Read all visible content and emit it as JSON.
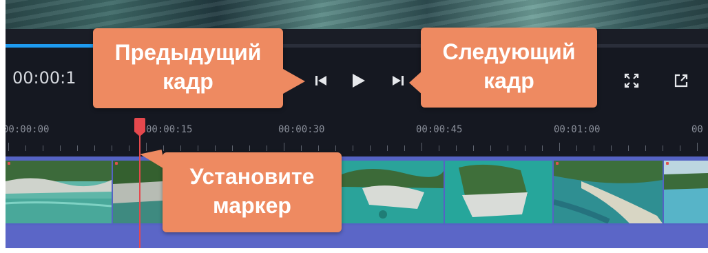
{
  "player": {
    "timecode": "00:00:1",
    "progress_fraction": 0.13,
    "accent_color": "#1e9bf0",
    "buttons": {
      "prev_frame_icon": "skip-previous-icon",
      "play_icon": "play-icon",
      "next_frame_icon": "skip-next-icon",
      "fullscreen_icon": "fullscreen-icon",
      "popout_icon": "open-external-icon"
    }
  },
  "timeline": {
    "ruler_labels": [
      "00:00:00",
      "00:00:15",
      "00:00:30",
      "00:00:45",
      "00:01:00",
      "00"
    ],
    "track_color": "#5563c4",
    "playhead_color": "#e5484d",
    "clips": [
      {
        "scene": "coast-cliffs"
      },
      {
        "scene": "rocky-shore"
      },
      {
        "scene": "cove"
      },
      {
        "scene": "turquoise-water"
      },
      {
        "scene": "rocky-islet"
      },
      {
        "scene": "green-cliff"
      },
      {
        "scene": "beach-bay"
      },
      {
        "scene": "distant-coast"
      }
    ]
  },
  "callouts": {
    "prev_frame": {
      "line1": "Предыдущий",
      "line2": "кадр"
    },
    "next_frame": {
      "line1": "Следующий",
      "line2": "кадр"
    },
    "set_marker": {
      "line1": "Установите",
      "line2": "маркер"
    },
    "color": "#ee8a61"
  }
}
